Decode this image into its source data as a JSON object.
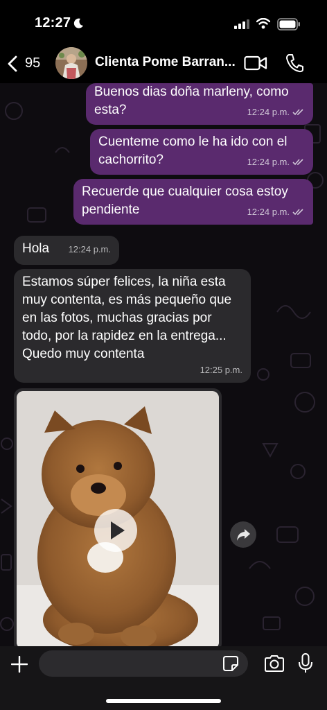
{
  "status_bar": {
    "time": "12:27",
    "icons": [
      "moon-icon",
      "signal-icon",
      "wifi-icon",
      "battery-icon"
    ]
  },
  "header": {
    "back_count": "95",
    "contact_name": "Clienta Pome Barran...",
    "icons": [
      "chevron-left-icon",
      "video-call-icon",
      "phone-icon"
    ]
  },
  "messages": [
    {
      "direction": "out",
      "text": "Buenos dias doña marleny, como esta?",
      "time": "12:24 p.m.",
      "status": "read"
    },
    {
      "direction": "out",
      "text": "Cuenteme como le ha ido con el cachorrito?",
      "time": "12:24 p.m.",
      "status": "read"
    },
    {
      "direction": "out",
      "text": "Recuerde que cualquier cosa estoy pendiente",
      "time": "12:24 p.m.",
      "status": "read"
    },
    {
      "direction": "in",
      "text": "Hola",
      "time": "12:24 p.m."
    },
    {
      "direction": "in",
      "text": "Estamos súper felices, la niña esta muy contenta, es más pequeño que en las fotos, muchas gracias por todo, por la rapidez en la entrega... Quedo muy contenta",
      "time": "12:25 p.m."
    }
  ],
  "media": {
    "type": "video",
    "subject": "pomeranian-puppy",
    "icons": [
      "play-icon",
      "forward-icon"
    ]
  },
  "input_bar": {
    "placeholder": "",
    "icons": [
      "plus-icon",
      "sticker-icon",
      "camera-icon",
      "mic-icon"
    ]
  },
  "colors": {
    "outgoing_bubble": "#5a2a6e",
    "incoming_bubble": "#2b2a2d",
    "background": "#0e0c10"
  }
}
